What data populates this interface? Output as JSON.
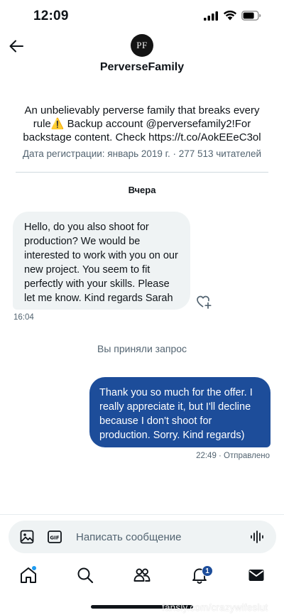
{
  "status_bar": {
    "time": "12:09"
  },
  "header": {
    "avatar_initials": "PF",
    "display_name": "PerverseFamily"
  },
  "profile": {
    "bio": "An unbelievably perverse family that breaks every rule⚠️ Backup account @perversefamily2!For backstage content. Check https://t.co/AokEEeC3ol",
    "meta": "Дата регистрации: январь 2019 г. · 277 513 читателей"
  },
  "conversation": {
    "date_separator": "Вчера",
    "incoming": {
      "text": "Hello, do you also shoot for production? We would be interested to work with you on our new project. You seem to fit perfectly with your skills.  Please let me know. Kind regards Sarah",
      "time": "16:04"
    },
    "system_message": "Вы приняли запрос",
    "outgoing": {
      "text": "Thank you so much for the offer. I really appreciate it, but I'll decline because I don't shoot for production. Sorry. Kind regards)",
      "status": "22:49 · Отправлено"
    }
  },
  "composer": {
    "placeholder": "Написать сообщение"
  },
  "tab_bar": {
    "notifications_badge": "1"
  },
  "watermark": "fansly.com/crazywifeslut",
  "colors": {
    "accent": "#1d4d9a",
    "bubble_in": "#eff3f4",
    "secondary_text": "#536471"
  }
}
